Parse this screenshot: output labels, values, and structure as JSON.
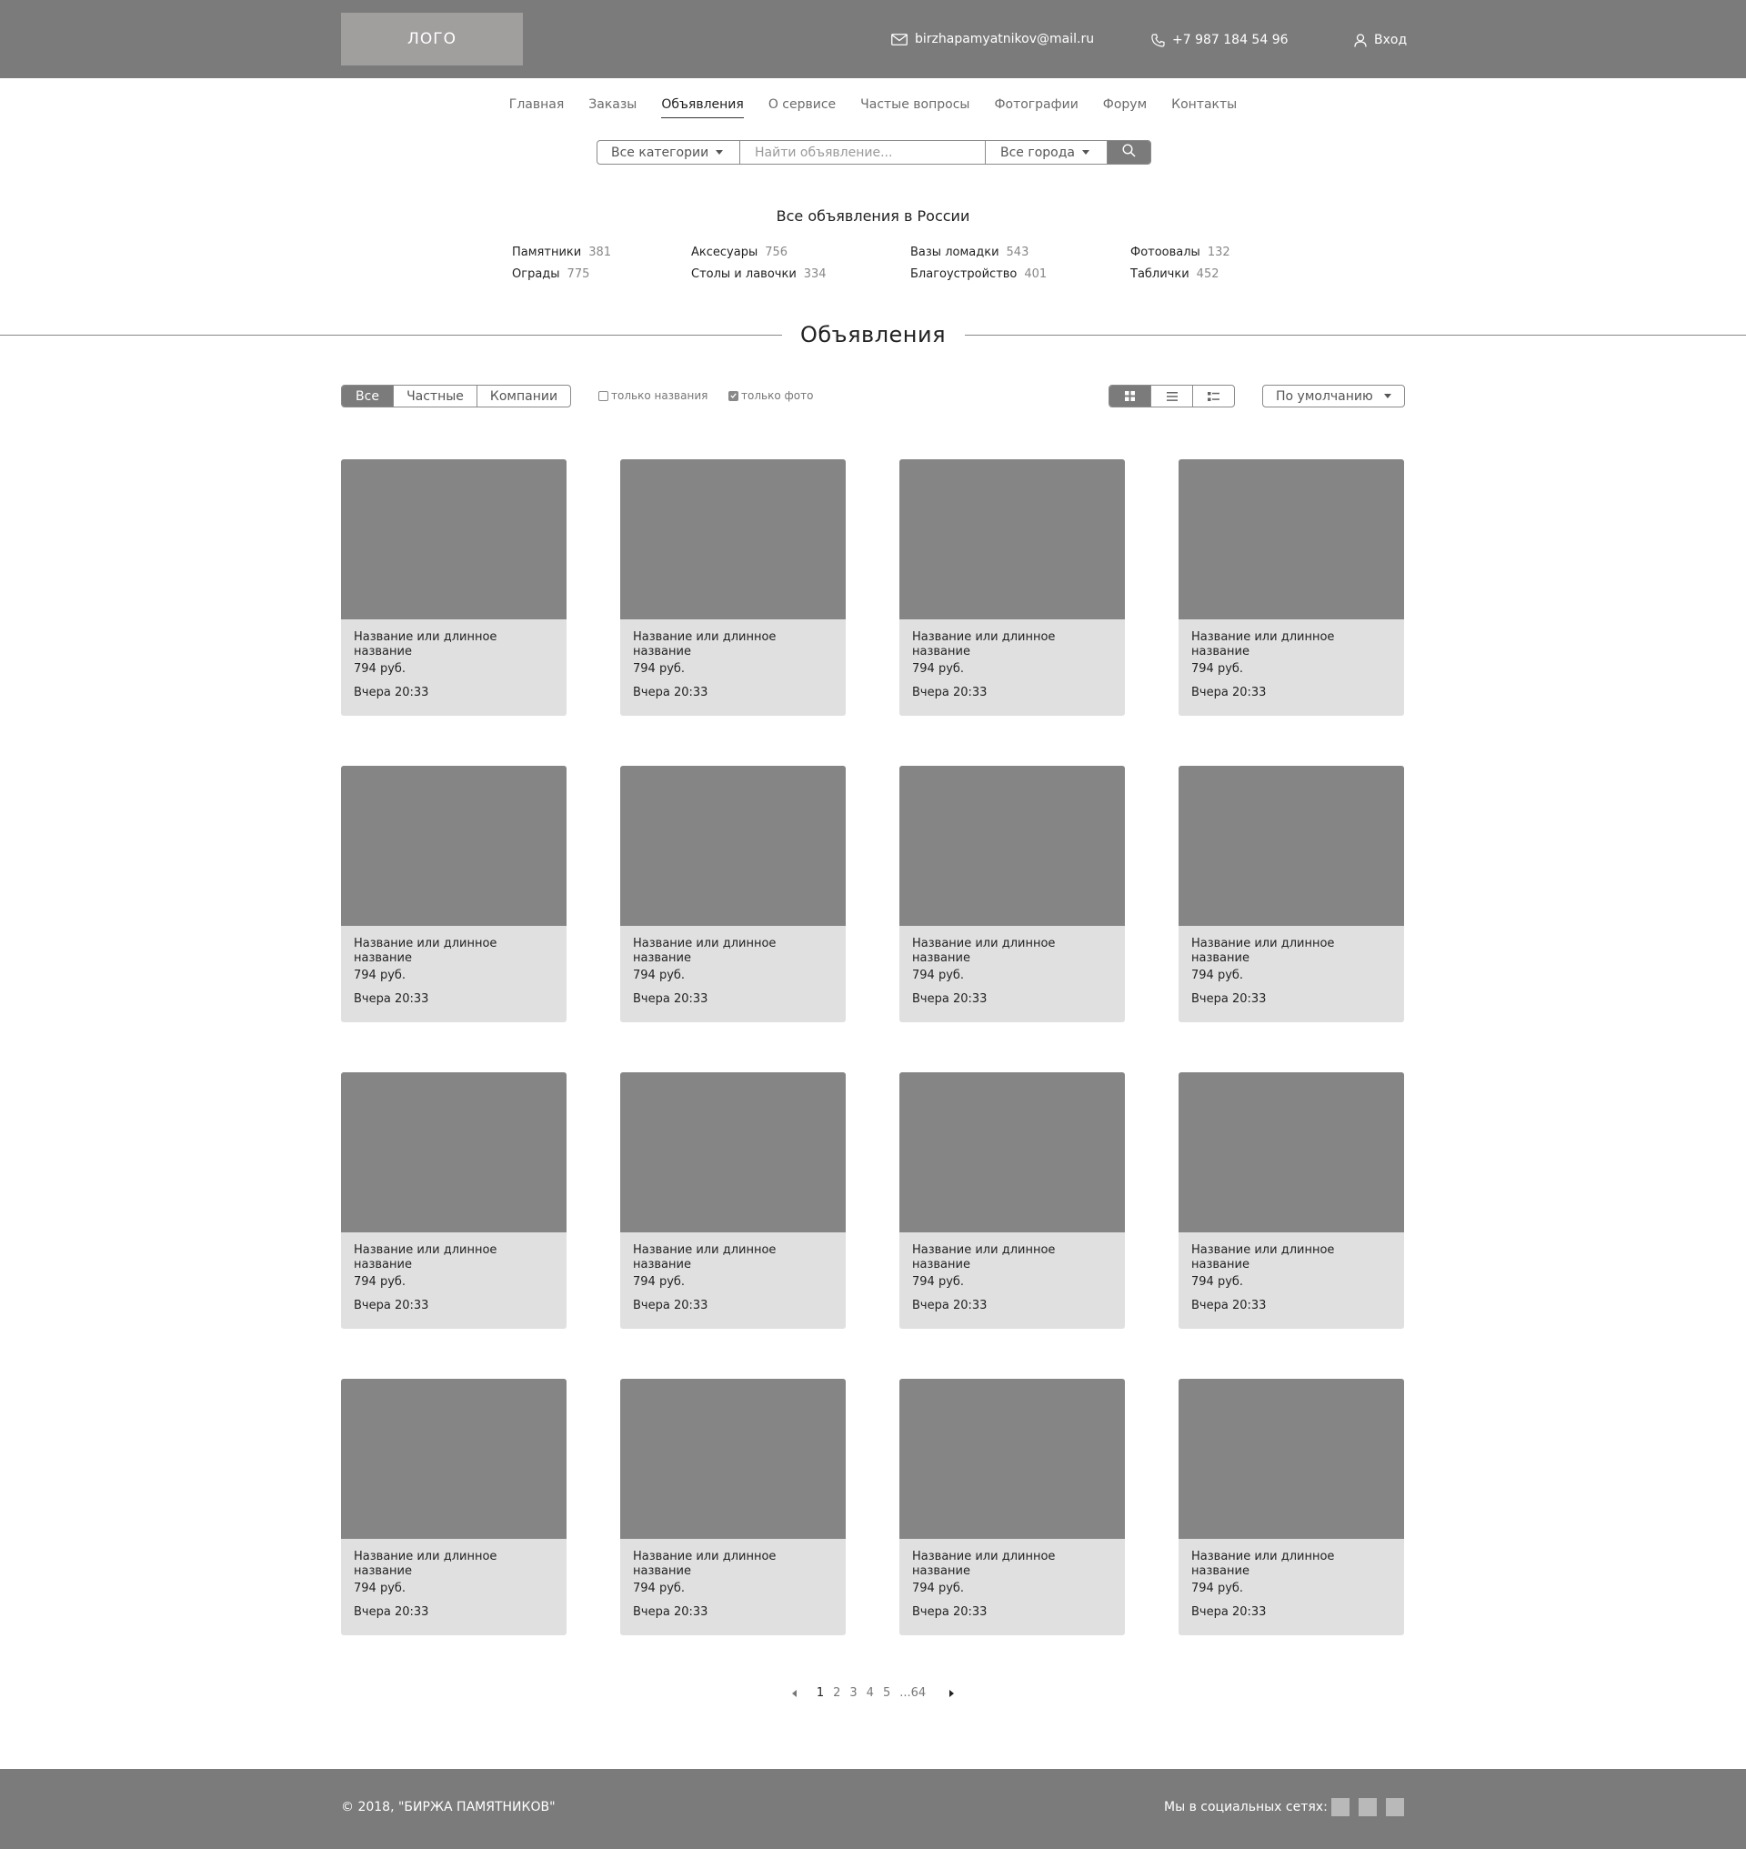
{
  "header": {
    "logo": "ЛОГО",
    "email": "birzhapamyatnikov@mail.ru",
    "phone": "+7 987 184 54 96",
    "login": "Вход"
  },
  "nav": [
    "Главная",
    "Заказы",
    "Объявления",
    "О сервисе",
    "Частые вопросы",
    "Фотографии",
    "Форум",
    "Контакты"
  ],
  "nav_active": "Объявления",
  "search": {
    "category": "Все категории",
    "placeholder": "Найти объявление...",
    "city": "Все города"
  },
  "categories": {
    "title": "Все объявления в России",
    "items": [
      {
        "name": "Памятники",
        "count": "381"
      },
      {
        "name": "Ограды",
        "count": "775"
      },
      {
        "name": "Аксесуары",
        "count": "756"
      },
      {
        "name": "Столы и лавочки",
        "count": "334"
      },
      {
        "name": "Вазы ломадки",
        "count": "543"
      },
      {
        "name": "Благоустройство",
        "count": "401"
      },
      {
        "name": "Фотоовалы",
        "count": "132"
      },
      {
        "name": "Таблички",
        "count": "452"
      }
    ]
  },
  "section_title": "Объявления",
  "filters": {
    "segments": [
      "Все",
      "Частные",
      "Компании"
    ],
    "active_segment": "Все",
    "only_names": "только названия",
    "only_names_checked": false,
    "only_photo": "только фото",
    "only_photo_checked": true,
    "active_view": "grid",
    "sort": "По умолчанию"
  },
  "listings": [
    {
      "title": "Название или длинное название",
      "price": "794 руб.",
      "date": "Вчера 20:33"
    },
    {
      "title": "Название или длинное название",
      "price": "794 руб.",
      "date": "Вчера 20:33"
    },
    {
      "title": "Название или длинное название",
      "price": "794 руб.",
      "date": "Вчера 20:33"
    },
    {
      "title": "Название или длинное название",
      "price": "794 руб.",
      "date": "Вчера 20:33"
    },
    {
      "title": "Название или длинное название",
      "price": "794 руб.",
      "date": "Вчера 20:33"
    },
    {
      "title": "Название или длинное название",
      "price": "794 руб.",
      "date": "Вчера 20:33"
    },
    {
      "title": "Название или длинное название",
      "price": "794 руб.",
      "date": "Вчера 20:33"
    },
    {
      "title": "Название или длинное название",
      "price": "794 руб.",
      "date": "Вчера 20:33"
    },
    {
      "title": "Название или длинное название",
      "price": "794 руб.",
      "date": "Вчера 20:33"
    },
    {
      "title": "Название или длинное название",
      "price": "794 руб.",
      "date": "Вчера 20:33"
    },
    {
      "title": "Название или длинное название",
      "price": "794 руб.",
      "date": "Вчера 20:33"
    },
    {
      "title": "Название или длинное название",
      "price": "794 руб.",
      "date": "Вчера 20:33"
    },
    {
      "title": "Название или длинное название",
      "price": "794 руб.",
      "date": "Вчера 20:33"
    },
    {
      "title": "Название или длинное название",
      "price": "794 руб.",
      "date": "Вчера 20:33"
    },
    {
      "title": "Название или длинное название",
      "price": "794 руб.",
      "date": "Вчера 20:33"
    },
    {
      "title": "Название или длинное название",
      "price": "794 руб.",
      "date": "Вчера 20:33"
    }
  ],
  "pagination": {
    "pages": [
      "1",
      "2",
      "3",
      "4",
      "5"
    ],
    "current": "1",
    "last": "...64"
  },
  "footer": {
    "copyright": "© 2018, \"БИРЖА ПАМЯТНИКОВ\"",
    "social_label": "Мы в социальных сетях:"
  },
  "colors": {
    "header_bg": "#7b7b7b",
    "logo_bg": "#a19e9e",
    "card_bg": "#e0e0e0",
    "card_image": "#868585"
  }
}
